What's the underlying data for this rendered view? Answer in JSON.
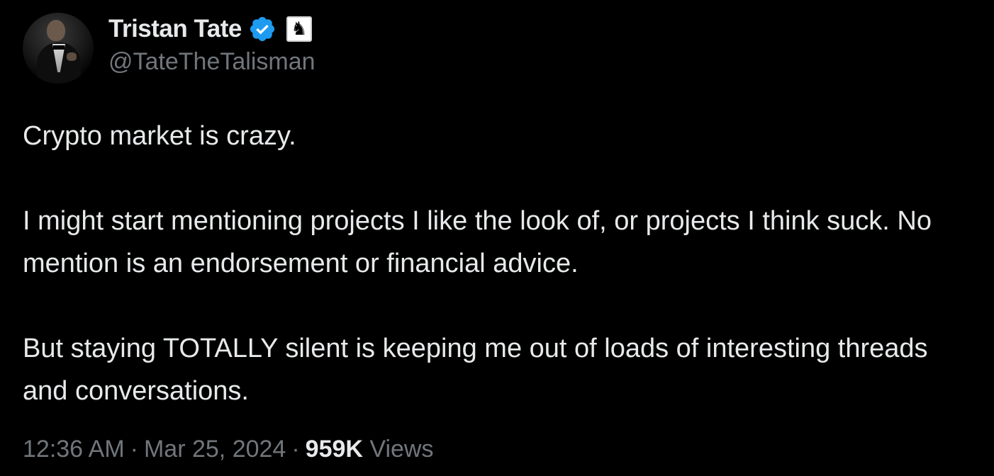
{
  "author": {
    "display_name": "Tristan Tate",
    "handle": "@TateTheTalisman",
    "verified_icon": "verified-badge-icon",
    "affiliate_icon": "chess-knight-icon"
  },
  "tweet": {
    "paragraphs": [
      "Crypto market is crazy.",
      "I might start mentioning projects I like the look of, or projects I think suck. No mention is an endorsement or financial advice.",
      "But staying TOTALLY silent is keeping me out of loads of interesting threads and conversations."
    ]
  },
  "meta": {
    "time": "12:36 AM",
    "separator": "·",
    "date": "Mar 25, 2024",
    "views_count": "959K",
    "views_label": "Views"
  },
  "colors": {
    "background": "#000000",
    "text_primary": "#e7e9ea",
    "text_secondary": "#71767b",
    "verified_blue": "#1d9bf0"
  }
}
